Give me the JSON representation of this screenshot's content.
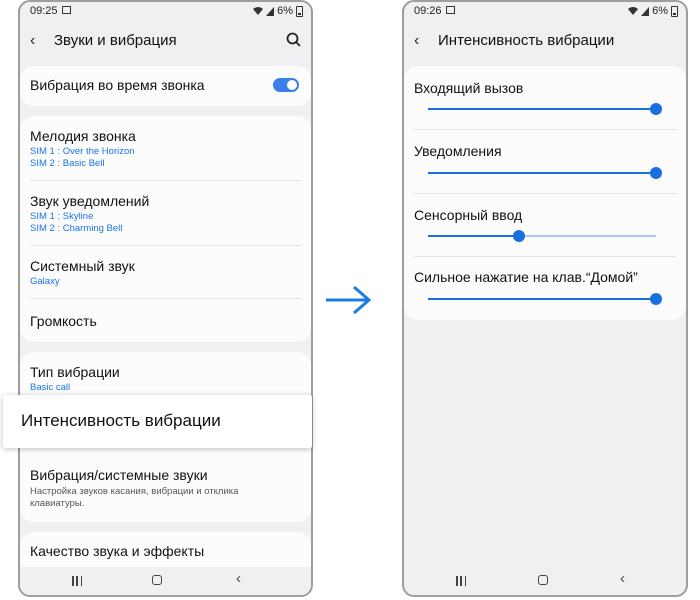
{
  "left_screen": {
    "status": {
      "time": "09:25",
      "battery": "6%"
    },
    "header": {
      "title": "Звуки и вибрация"
    },
    "vibrate_while_ringing": {
      "label": "Вибрация во время звонка",
      "enabled": true
    },
    "ringtone": {
      "title": "Мелодия звонка",
      "sim1": "SIM 1 : Over the Horizon",
      "sim2": "SIM 2 : Basic Bell"
    },
    "notification_sound": {
      "title": "Звук уведомлений",
      "sim1": "SIM 1 : Skyline",
      "sim2": "SIM 2 : Charming Bell"
    },
    "system_sound": {
      "title": "Системный звук",
      "value": "Galaxy"
    },
    "volume": {
      "title": "Громкость"
    },
    "vibration_pattern": {
      "title": "Тип вибрации",
      "value": "Basic call"
    },
    "vibration_intensity": {
      "title": "Интенсивность вибрации"
    },
    "vibration_system_sounds": {
      "title": "Вибрация/системные звуки",
      "description": "Настройка звуков касания, вибрации и отклика клавиатуры."
    },
    "sound_quality": {
      "title": "Качество звука и эффекты"
    }
  },
  "right_screen": {
    "status": {
      "time": "09:26",
      "battery": "6%"
    },
    "header": {
      "title": "Интенсивность вибрации"
    },
    "sliders": [
      {
        "label": "Входящий вызов",
        "level": 1.0
      },
      {
        "label": "Уведомления",
        "level": 1.0
      },
      {
        "label": "Сенсорный ввод",
        "level": 0.4
      },
      {
        "label": "Сильное нажатие на клав.“Домой”",
        "level": 1.0
      }
    ]
  },
  "colors": {
    "accent": "#1a6fe0",
    "arrow": "#1e7be6",
    "track": "#a8c8f5",
    "screen_bg": "#f0f0f2"
  },
  "icons": [
    "back-icon",
    "search-icon",
    "wifi-icon",
    "signal-icon",
    "battery-icon",
    "arrow-right-icon"
  ]
}
